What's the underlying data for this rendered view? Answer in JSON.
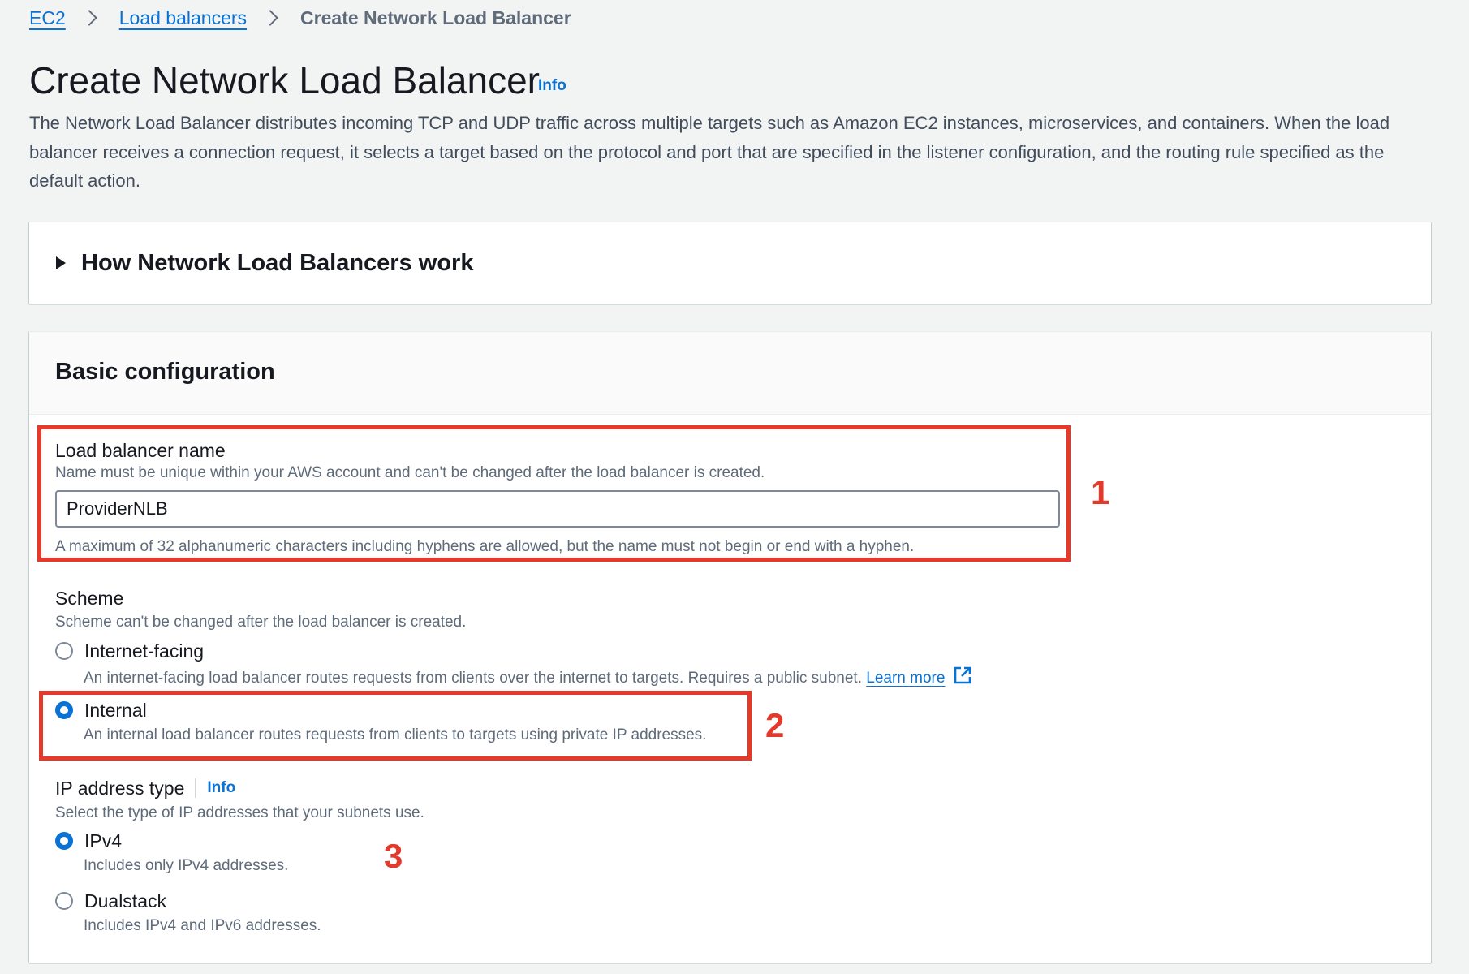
{
  "breadcrumb": {
    "items": [
      "EC2",
      "Load balancers"
    ],
    "current": "Create Network Load Balancer"
  },
  "header": {
    "title": "Create Network Load Balancer",
    "info": "Info",
    "description": "The Network Load Balancer distributes incoming TCP and UDP traffic across multiple targets such as Amazon EC2 instances, microservices, and containers. When the load balancer receives a connection request, it selects a target based on the protocol and port that are specified in the listener configuration, and the routing rule specified as the default action."
  },
  "how_it_works": {
    "label": "How Network Load Balancers work",
    "expanded": false
  },
  "basic_config": {
    "title": "Basic configuration",
    "name_field": {
      "label": "Load balancer name",
      "description": "Name must be unique within your AWS account and can't be changed after the load balancer is created.",
      "value": "ProviderNLB",
      "constraint": "A maximum of 32 alphanumeric characters including hyphens are allowed, but the name must not begin or end with a hyphen."
    },
    "scheme": {
      "label": "Scheme",
      "description": "Scheme can't be changed after the load balancer is created.",
      "options": [
        {
          "label": "Internet-facing",
          "description": "An internet-facing load balancer routes requests from clients over the internet to targets. Requires a public subnet.",
          "link": "Learn more",
          "selected": false
        },
        {
          "label": "Internal",
          "description": "An internal load balancer routes requests from clients to targets using private IP addresses.",
          "selected": true
        }
      ]
    },
    "ip_type": {
      "label": "IP address type",
      "info": "Info",
      "description": "Select the type of IP addresses that your subnets use.",
      "options": [
        {
          "label": "IPv4",
          "description": "Includes only IPv4 addresses.",
          "selected": true
        },
        {
          "label": "Dualstack",
          "description": "Includes IPv4 and IPv6 addresses.",
          "selected": false
        }
      ]
    }
  },
  "annotations": [
    "1",
    "2",
    "3"
  ],
  "colors": {
    "accent": "#0972d3",
    "annotation": "#e43a2b",
    "background": "#f2f3f3"
  }
}
